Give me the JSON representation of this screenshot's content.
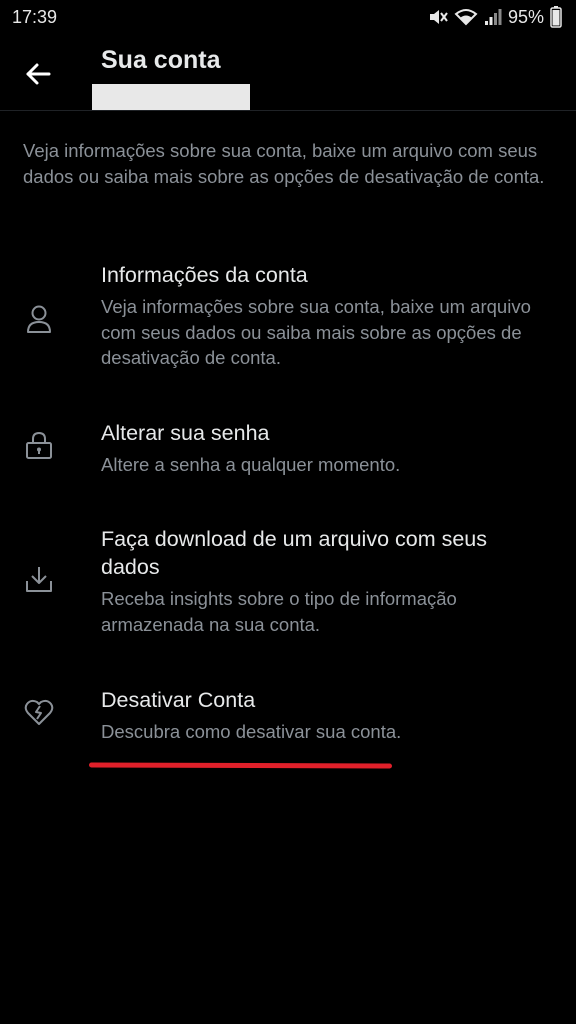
{
  "status_bar": {
    "time": "17:39",
    "battery_percent": "95%"
  },
  "header": {
    "title": "Sua conta"
  },
  "intro_text": "Veja informações sobre sua conta, baixe um arquivo com seus dados ou saiba mais sobre as opções de desativação de conta.",
  "menu": [
    {
      "icon": "person-icon",
      "title": "Informações da conta",
      "description": "Veja informações sobre sua conta, baixe um arquivo com seus dados ou saiba mais sobre as opções de desativação de conta."
    },
    {
      "icon": "lock-icon",
      "title": "Alterar sua senha",
      "description": "Altere a senha a qualquer momento."
    },
    {
      "icon": "download-icon",
      "title": "Faça download de um arquivo com seus dados",
      "description": "Receba insights sobre o tipo de informação armazenada na sua conta."
    },
    {
      "icon": "broken-heart-icon",
      "title": "Desativar Conta",
      "description": "Descubra como desativar sua conta."
    }
  ],
  "colors": {
    "background": "#000000",
    "primary_text": "#e7e9ea",
    "secondary_text": "#8b9198",
    "annotation_red": "#e0202a"
  }
}
